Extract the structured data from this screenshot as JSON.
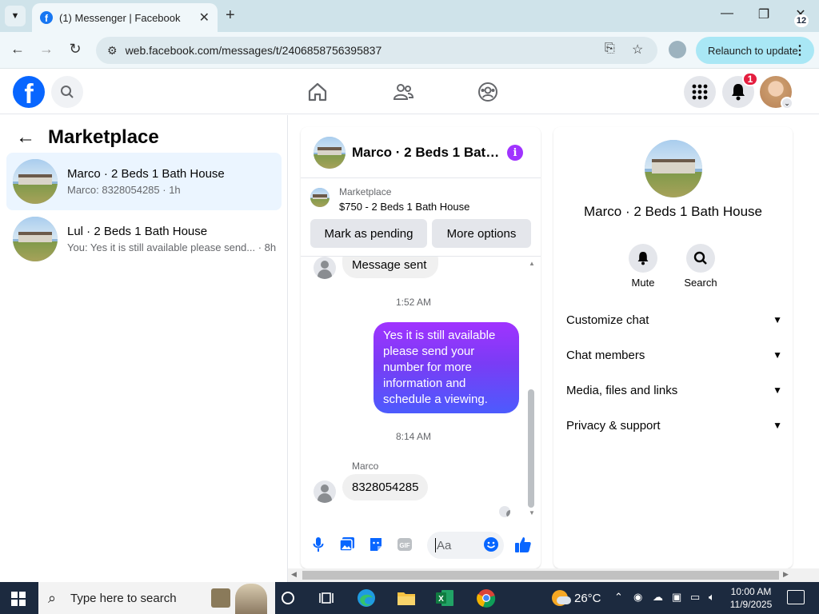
{
  "browser": {
    "tab_title": "(1) Messenger | Facebook",
    "url": "web.facebook.com/messages/t/2406858756395837",
    "relaunch_label": "Relaunch to update"
  },
  "facebook": {
    "notification_count": "1"
  },
  "left_panel": {
    "title": "Marketplace",
    "conversations": [
      {
        "name": "Marco · 2 Beds 1 Bath House",
        "preview": "Marco: 8328054285 · 1h",
        "active": true
      },
      {
        "name": "Lul · 2 Beds 1 Bath House",
        "preview": "You: Yes it is still available please send... · 8h",
        "active": false
      }
    ]
  },
  "chat": {
    "title": "Marco · 2 Beds 1 Bat…",
    "marketplace_label": "Marketplace",
    "listing": "$750 - 2 Beds 1 Bath House",
    "mark_pending_label": "Mark as pending",
    "more_options_label": "More options",
    "messages": {
      "msg1": "Message sent",
      "time1": "1:52 AM",
      "outgoing": "Yes it is still available please send your number for more information and schedule a viewing.",
      "time2": "8:14 AM",
      "sender": "Marco",
      "incoming": "8328054285"
    },
    "composer_placeholder": "Aa"
  },
  "right_panel": {
    "name": "Marco · 2 Beds 1 Bath House",
    "mute_label": "Mute",
    "search_label": "Search",
    "rows": [
      "Customize chat",
      "Chat members",
      "Media, files and links",
      "Privacy & support"
    ]
  },
  "taskbar": {
    "search_placeholder": "Type here to search",
    "temperature": "26°C",
    "time": "10:00 AM",
    "date": "11/9/2025",
    "notification_count": "12"
  },
  "colors": {
    "fb_blue": "#0866ff",
    "messenger_gradient_top": "#a033ff",
    "messenger_gradient_bottom": "#4c5bfd",
    "active_conv_bg": "#ebf5ff"
  }
}
